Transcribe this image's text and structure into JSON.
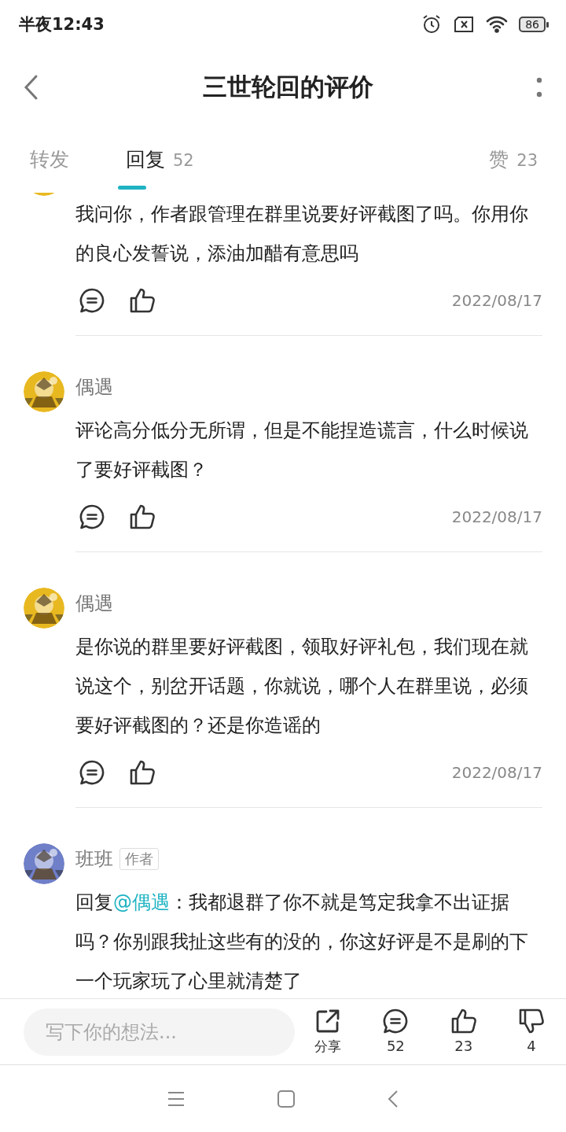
{
  "status_bar": {
    "time": "半夜12:43",
    "battery": "86"
  },
  "header": {
    "title": "三世轮回的评价"
  },
  "tabs": [
    {
      "label": "转发",
      "selected": false
    },
    {
      "label": "回复",
      "count": "52",
      "selected": true
    },
    {
      "label": "赞",
      "count": "23",
      "selected": false
    }
  ],
  "comments": [
    {
      "text": "我问你，作者跟管理在群里说要好评截图了吗。你用你的良心发誓说，添油加醋有意思吗",
      "date": "2022/08/17"
    },
    {
      "name": "偶遇",
      "text": "评论高分低分无所谓，但是不能捏造谎言，什么时候说了要好评截图？",
      "date": "2022/08/17"
    },
    {
      "name": "偶遇",
      "text": "是你说的群里要好评截图，领取好评礼包，我们现在就说这个，别岔开话题，你就说，哪个人在群里说，必须要好评截图的？还是你造谣的",
      "date": "2022/08/17"
    },
    {
      "name": "班班",
      "badge": "作者",
      "reply_to": {
        "prefix": "回复",
        "mention": "@偶遇"
      },
      "text": "：我都退群了你不就是笃定我拿不出证据吗？你别跟我扯这些有的没的，你这好评是不是刷的下一个玩家玩了心里就清楚了"
    }
  ],
  "bottom_bar": {
    "placeholder": "写下你的想法...",
    "actions": [
      {
        "kind": "share",
        "label": "分享"
      },
      {
        "kind": "comment",
        "label": "52"
      },
      {
        "kind": "like",
        "label": "23"
      },
      {
        "kind": "dislike",
        "label": "4"
      }
    ]
  }
}
